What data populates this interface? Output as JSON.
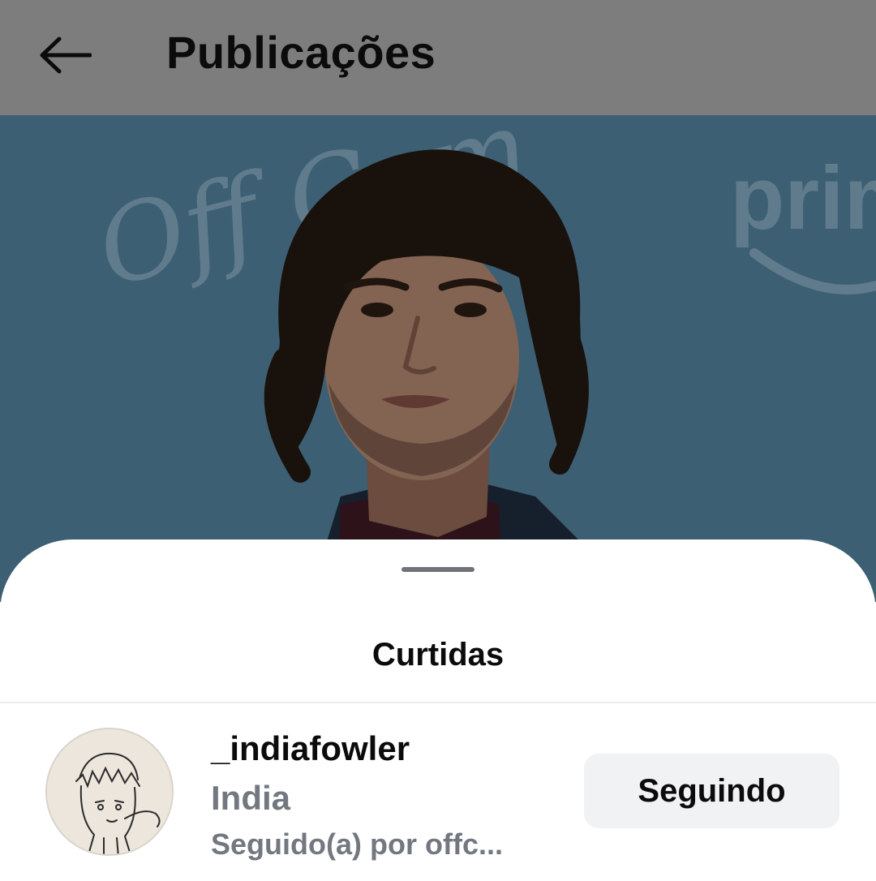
{
  "header": {
    "back_icon": "arrow-left-icon",
    "title": "Publicações"
  },
  "post": {
    "backdrop_color": "#4f7a94",
    "backdrop_text_left": "Off Cam",
    "backdrop_text_right": "prim"
  },
  "sheet": {
    "title": "Curtidas"
  },
  "likers": [
    {
      "username": "_indiafowler",
      "name": "India",
      "followed_by": "Seguido(a) por offc...",
      "button_label": "Seguindo"
    }
  ],
  "colors": {
    "topbar_dim": "#7d7d7d",
    "secondary_text": "#737880",
    "button_bg": "#f1f2f4"
  }
}
